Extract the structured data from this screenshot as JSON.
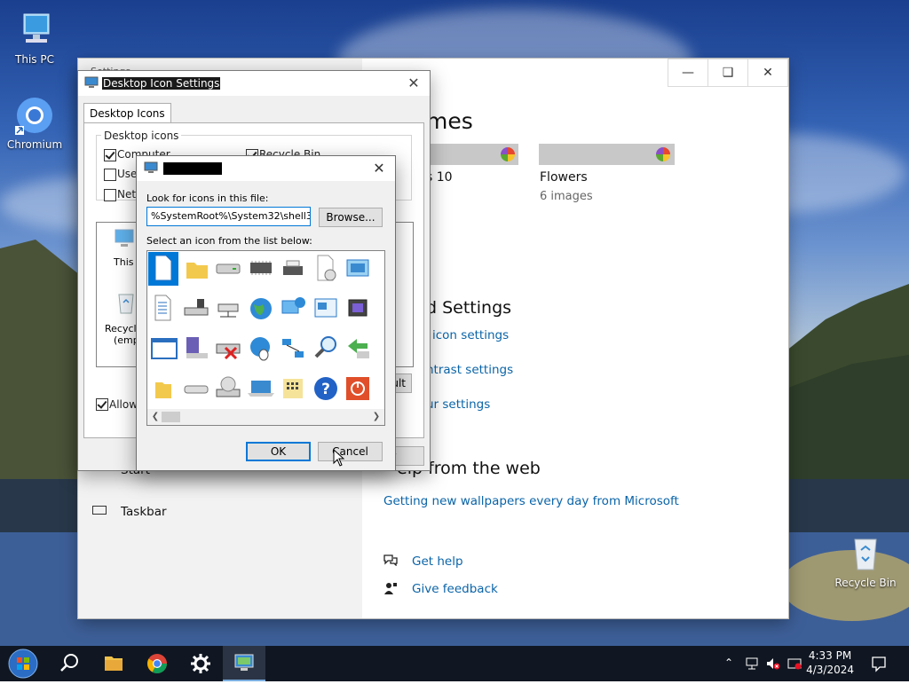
{
  "desktop": {
    "icons": [
      {
        "label": "This PC"
      },
      {
        "label": "Chromium"
      },
      {
        "label": "Recycle Bin"
      }
    ]
  },
  "settings_window": {
    "title": "Settings",
    "caption_buttons": [
      "minimize",
      "maximize",
      "close"
    ],
    "themes_heading": "Themes",
    "themes_heading_visible": "mes",
    "themes": [
      {
        "name": "Windows 10",
        "name_visible": "s 10",
        "count": ""
      },
      {
        "name": "Flowers",
        "count": "6 images"
      }
    ],
    "related_settings_heading": "Related Settings",
    "related_settings_visible": "d Settings",
    "related_links": [
      {
        "label": "Desktop icon settings",
        "visible": "icon settings"
      },
      {
        "label": "High contrast settings",
        "visible": "ntrast settings"
      },
      {
        "label": "Sync your settings",
        "visible": "ur settings"
      }
    ],
    "help_heading": "Help from the web",
    "help_heading_visible": "elp from the web",
    "help_link": "Getting new wallpapers every day from Microsoft",
    "get_help": "Get help",
    "give_feedback": "Give feedback",
    "left_items": [
      {
        "label": "Start",
        "icon": "start-menu-icon"
      },
      {
        "label": "Taskbar",
        "icon": "taskbar-icon"
      }
    ]
  },
  "desktop_icon_settings": {
    "title": "Desktop Icon Settings",
    "tab": "Desktop Icons",
    "group_label": "Desktop icons",
    "checkboxes": [
      {
        "label": "Computer",
        "checked": true
      },
      {
        "label": "Recycle Bin",
        "checked": true
      },
      {
        "label": "User's Files",
        "visible": "User",
        "checked": false
      },
      {
        "label": "Network",
        "visible": "Netw",
        "checked": false
      }
    ],
    "icon_items": [
      {
        "label": "This PC",
        "visible": "This F"
      },
      {
        "label": "Recycle Bin (empty)",
        "visible_1": "Recycle",
        "visible_2": "(empt"
      }
    ],
    "restore_default": "Restore Default",
    "restore_visible": "ult",
    "allow_themes": "Allow themes to change desktop icons",
    "allow_visible": "Allow t",
    "allow_checked": true,
    "apply": "Apply",
    "apply_visible": "ly"
  },
  "change_icon": {
    "title_redacted": true,
    "look_label": "Look for icons in this file:",
    "file_path": "%SystemRoot%\\System32\\shell32.dll",
    "file_path_visible": "%SystemRoot%\\System32\\shell32.c",
    "browse": "Browse...",
    "select_label": "Select an icon from the list below:",
    "icons": [
      "blank-document-icon",
      "folder-icon",
      "drive-icon",
      "memory-chip-icon",
      "printer-icon",
      "document-clock-icon",
      "window-app-icon",
      "partial-icon",
      "text-document-icon",
      "network-drive-icon",
      "network-computer-icon",
      "globe-icon",
      "computer-network-icon",
      "presentation-icon",
      "chip-icon",
      "shortcut-icon",
      "window-icon",
      "floppy-icon",
      "disconnected-drive-icon",
      "globe-mouse-icon",
      "network-nodes-icon",
      "magnifier-icon",
      "green-arrow-icon",
      "clock-overlay-icon",
      "folder-small-icon",
      "drive-flat-icon",
      "cd-drive-icon",
      "laptop-icon",
      "keypad-icon",
      "help-icon",
      "power-icon",
      "partial2-icon"
    ],
    "selected_index": 0,
    "ok": "OK",
    "cancel": "Cancel"
  },
  "taskbar": {
    "items": [
      "start-button",
      "search-icon",
      "file-explorer-icon",
      "chromium-icon",
      "settings-icon",
      "desktop-icon-settings-taskbar-icon"
    ],
    "time": "4:33 PM",
    "date": "4/3/2024"
  }
}
